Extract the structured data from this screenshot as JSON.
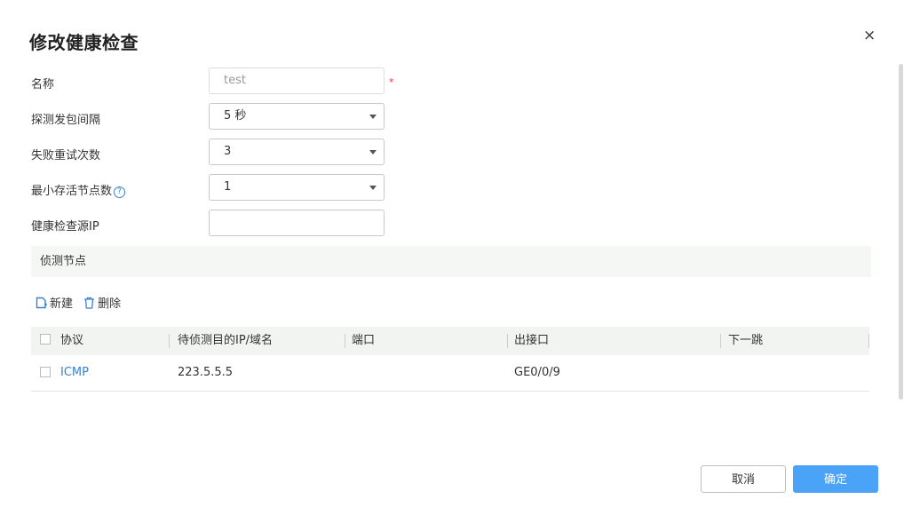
{
  "dialog": {
    "title": "修改健康检查",
    "close_glyph": "×"
  },
  "form": {
    "name": {
      "label": "名称",
      "value": "test",
      "required_mark": "*"
    },
    "interval": {
      "label": "探测发包间隔",
      "value": "5 秒"
    },
    "retries": {
      "label": "失败重试次数",
      "value": "3"
    },
    "min_alive": {
      "label": "最小存活节点数",
      "value": "1",
      "help_glyph": "?"
    },
    "source_ip": {
      "label": "健康检查源IP",
      "value": ""
    }
  },
  "section": {
    "title": "侦测节点"
  },
  "toolbar": {
    "new_label": "新建",
    "delete_label": "删除"
  },
  "table": {
    "headers": [
      "协议",
      "待侦测目的IP/域名",
      "端口",
      "出接口",
      "下一跳"
    ],
    "rows": [
      {
        "protocol": "ICMP",
        "target": "223.5.5.5",
        "port": "",
        "interface": "GE0/0/9",
        "next_hop": ""
      }
    ]
  },
  "footer": {
    "cancel_label": "取消",
    "ok_label": "确定"
  },
  "colors": {
    "accent": "#4aa3f6",
    "link": "#3a80d6",
    "required": "#e53935"
  }
}
